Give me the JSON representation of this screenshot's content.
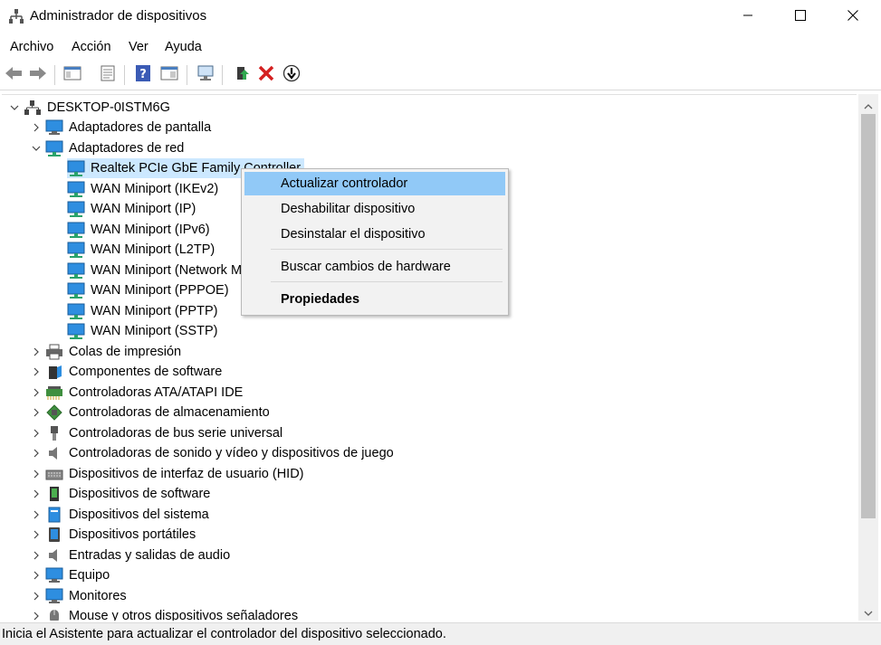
{
  "window": {
    "title": "Administrador de dispositivos",
    "controls": {
      "minimize": "minimize-icon",
      "maximize": "maximize-icon",
      "close": "close-icon"
    }
  },
  "menu": [
    "Archivo",
    "Acción",
    "Ver",
    "Ayuda"
  ],
  "toolbar": [
    "back-icon",
    "forward-icon",
    "show-hide-tree-icon",
    "properties-icon",
    "help-icon",
    "action-pane-icon",
    "scan-hardware-icon",
    "update-driver-icon",
    "uninstall-icon",
    "disable-device-icon"
  ],
  "tree": {
    "root": "DESKTOP-0ISTM6G",
    "cat_display": "Adaptadores de pantalla",
    "cat_network": "Adaptadores de red",
    "network_children": [
      "Realtek PCIe GbE Family Controller",
      "WAN Miniport (IKEv2)",
      "WAN Miniport (IP)",
      "WAN Miniport (IPv6)",
      "WAN Miniport (L2TP)",
      "WAN Miniport (Network Monitor)",
      "WAN Miniport (PPPOE)",
      "WAN Miniport (PPTP)",
      "WAN Miniport (SSTP)"
    ],
    "categories": [
      "Colas de impresión",
      "Componentes de software",
      "Controladoras ATA/ATAPI IDE",
      "Controladoras de almacenamiento",
      "Controladoras de bus serie universal",
      "Controladoras de sonido y vídeo y dispositivos de juego",
      "Dispositivos de interfaz de usuario (HID)",
      "Dispositivos de software",
      "Dispositivos del sistema",
      "Dispositivos portátiles",
      "Entradas y salidas de audio",
      "Equipo",
      "Monitores",
      "Mouse y otros dispositivos señaladores"
    ]
  },
  "context_menu": {
    "update": "Actualizar controlador",
    "disable": "Deshabilitar dispositivo",
    "uninstall": "Desinstalar el dispositivo",
    "scan": "Buscar cambios de hardware",
    "properties": "Propiedades"
  },
  "status": "Inicia el Asistente para actualizar el controlador del dispositivo seleccionado."
}
